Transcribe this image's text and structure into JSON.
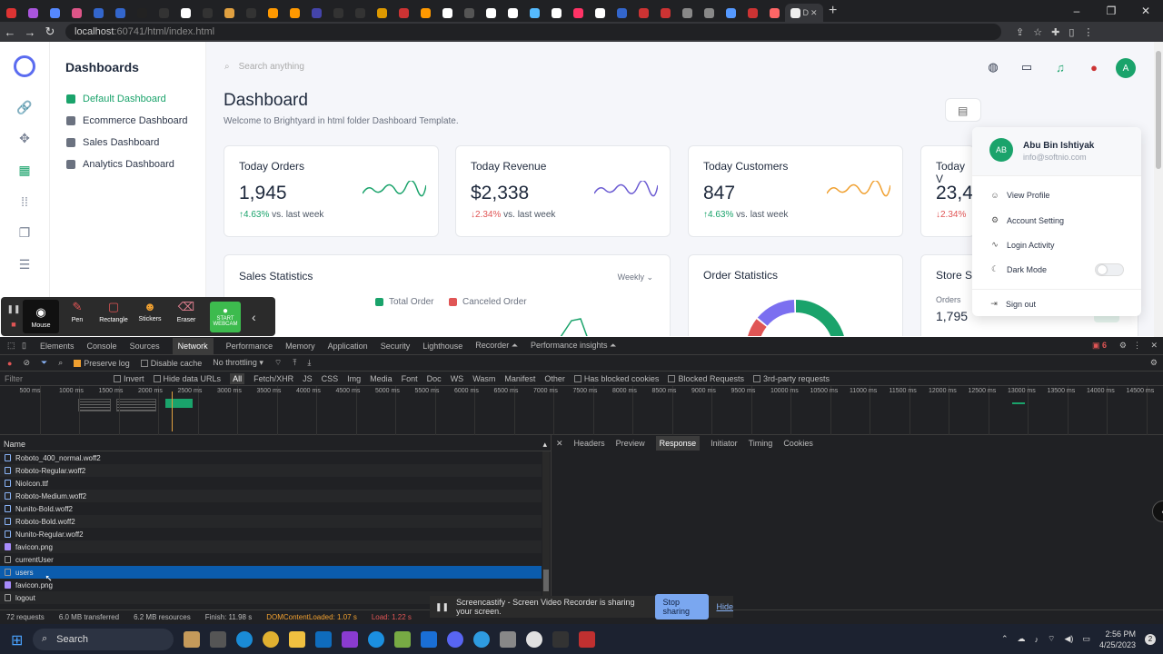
{
  "browser": {
    "active_tab_label": "D",
    "url_host": "localhost",
    "url_path": ":60741/html/index.html",
    "new_tab": "+",
    "win_min": "–",
    "win_max": "❐",
    "win_close": "✕"
  },
  "app": {
    "sidebar_title": "Dashboards",
    "nav": [
      "Default Dashboard",
      "Ecommerce Dashboard",
      "Sales Dashboard",
      "Analytics Dashboard"
    ],
    "search_placeholder": "Search anything",
    "page_title": "Dashboard",
    "page_subtitle": "Welcome to Brightyard in html folder Dashboard Template.",
    "avatar_initial": "A",
    "accent": "#1aa36b",
    "cards": [
      {
        "title": "Today Orders",
        "value": "1,945",
        "arrow": "↑",
        "delta": "4.63%",
        "suffix": "vs. last week",
        "color": "#1aa36b"
      },
      {
        "title": "Today Revenue",
        "value": "$2,338",
        "arrow": "↓",
        "delta": "2.34%",
        "suffix": "vs. last week",
        "color": "#6b5bd2"
      },
      {
        "title": "Today Customers",
        "value": "847",
        "arrow": "↑",
        "delta": "4.63%",
        "suffix": "vs. last week",
        "color": "#f0a030"
      },
      {
        "title": "Today V",
        "value": "23,4",
        "arrow": "↓",
        "delta": "2.34%",
        "suffix": "",
        "color": "#1aa36b"
      }
    ],
    "sales": {
      "title": "Sales Statistics",
      "period": "Weekly",
      "legend_total": "Total Order",
      "legend_canceled": "Canceled Order"
    },
    "orders": {
      "title": "Order Statistics"
    },
    "store": {
      "title": "Store Statistics",
      "label": "Orders",
      "value": "1,795"
    },
    "profile": {
      "initials": "AB",
      "name": "Abu Bin Ishtiyak",
      "email": "info@softnio.com",
      "items": [
        "View Profile",
        "Account Setting",
        "Login Activity",
        "Dark Mode"
      ],
      "signout": "Sign out"
    }
  },
  "screencastify": {
    "tools": [
      "Mouse",
      "Pen",
      "Rectangle",
      "Stickers",
      "Eraser"
    ],
    "webcam": "START WEBCAM"
  },
  "devtools": {
    "tabs": [
      "Elements",
      "Console",
      "Sources",
      "Network",
      "Performance",
      "Memory",
      "Application",
      "Security",
      "Lighthouse",
      "Recorder ⏶",
      "Performance insights ⏶"
    ],
    "issues": "6",
    "preserve_log": "Preserve log",
    "disable_cache": "Disable cache",
    "throttling": "No throttling",
    "filter_placeholder": "Filter",
    "filter_types": [
      "Invert",
      "Hide data URLs",
      "All",
      "Fetch/XHR",
      "JS",
      "CSS",
      "Img",
      "Media",
      "Font",
      "Doc",
      "WS",
      "Wasm",
      "Manifest",
      "Other",
      "Has blocked cookies",
      "Blocked Requests",
      "3rd-party requests"
    ],
    "ticks": [
      "500 ms",
      "1000 ms",
      "1500 ms",
      "2000 ms",
      "2500 ms",
      "3000 ms",
      "3500 ms",
      "4000 ms",
      "4500 ms",
      "5000 ms",
      "5500 ms",
      "6000 ms",
      "6500 ms",
      "7000 ms",
      "7500 ms",
      "8000 ms",
      "8500 ms",
      "9000 ms",
      "9500 ms",
      "10000 ms",
      "10500 ms",
      "11000 ms",
      "11500 ms",
      "12000 ms",
      "12500 ms",
      "13000 ms",
      "13500 ms",
      "14000 ms",
      "14500 ms"
    ],
    "name_header": "Name",
    "requests": [
      {
        "name": "Roboto_400_normal.woff2",
        "kind": "font"
      },
      {
        "name": "Roboto-Regular.woff2",
        "kind": "font"
      },
      {
        "name": "NioIcon.ttf",
        "kind": "font"
      },
      {
        "name": "Roboto-Medium.woff2",
        "kind": "font"
      },
      {
        "name": "Nunito-Bold.woff2",
        "kind": "font"
      },
      {
        "name": "Roboto-Bold.woff2",
        "kind": "font"
      },
      {
        "name": "Nunito-Regular.woff2",
        "kind": "font"
      },
      {
        "name": "favicon.png",
        "kind": "img"
      },
      {
        "name": "currentUser",
        "kind": "plain"
      },
      {
        "name": "users",
        "kind": "plain",
        "selected": true
      },
      {
        "name": "favicon.png",
        "kind": "img"
      },
      {
        "name": "logout",
        "kind": "plain"
      }
    ],
    "detail_tabs": [
      "Headers",
      "Preview",
      "Response",
      "Initiator",
      "Timing",
      "Cookies"
    ],
    "status": {
      "requests": "72 requests",
      "transferred": "6.0 MB transferred",
      "resources": "6.2 MB resources",
      "finish": "Finish: 11.98 s",
      "dcl": "DOMContentLoaded: 1.07 s",
      "load": "Load: 1.22 s"
    }
  },
  "share_banner": {
    "text": "Screencastify - Screen Video Recorder is sharing your screen.",
    "stop": "Stop sharing",
    "hide": "Hide"
  },
  "taskbar": {
    "search": "Search",
    "time": "2:56 PM",
    "date": "4/25/2023",
    "notif": "2"
  }
}
